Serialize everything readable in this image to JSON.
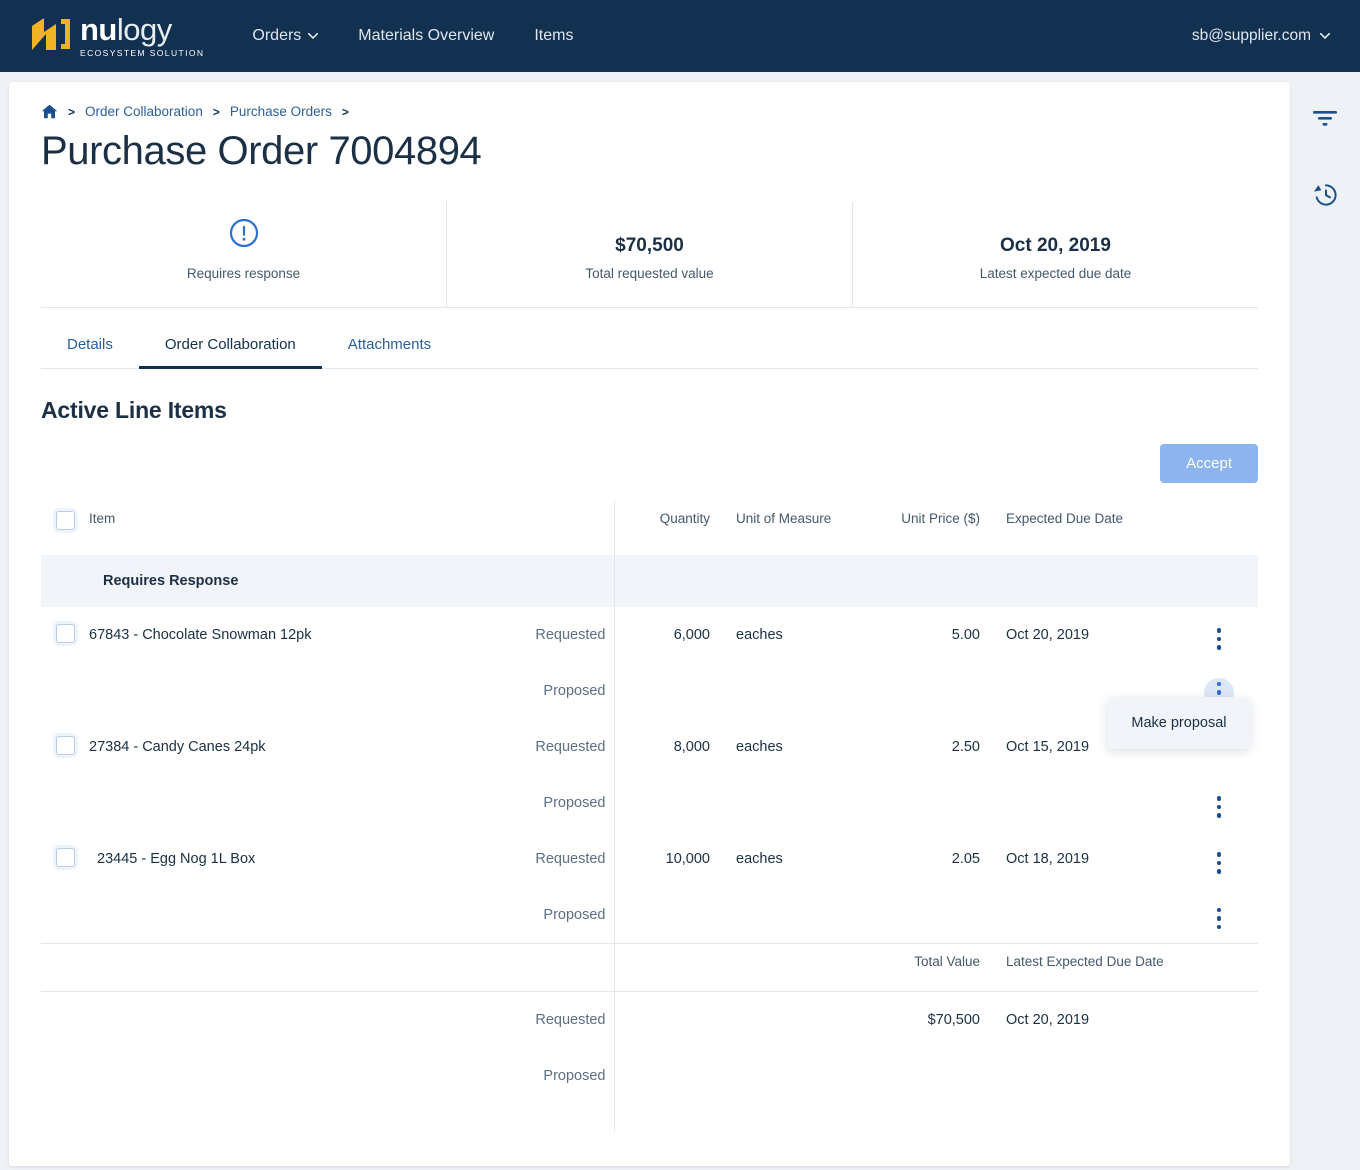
{
  "brand": {
    "word_bold": "nu",
    "word_light": "logy",
    "tagline": "ECOSYSTEM SOLUTION",
    "mark_color": "#f0b323",
    "navy": "#12304f",
    "accent_blue": "#2a5f9e"
  },
  "nav": {
    "items": [
      {
        "label": "Orders",
        "has_caret": true
      },
      {
        "label": "Materials Overview",
        "has_caret": false
      },
      {
        "label": "Items",
        "has_caret": false
      }
    ],
    "user_email": "sb@supplier.com"
  },
  "rail": {
    "filter_icon": "filter-icon",
    "history_icon": "history-icon"
  },
  "breadcrumb": {
    "home_icon": "home-icon",
    "items": [
      "Order Collaboration",
      "Purchase Orders"
    ],
    "separator": ">"
  },
  "page": {
    "title": "Purchase Order 7004894"
  },
  "stats": [
    {
      "icon": "alert-circle-icon",
      "value": "",
      "label": "Requires response"
    },
    {
      "icon": "",
      "value": "$70,500",
      "label": "Total requested value"
    },
    {
      "icon": "",
      "value": "Oct 20, 2019",
      "label": "Latest expected due date"
    }
  ],
  "tabs": [
    {
      "label": "Details",
      "active": false
    },
    {
      "label": "Order Collaboration",
      "active": true
    },
    {
      "label": "Attachments",
      "active": false
    }
  ],
  "section": {
    "title": "Active Line Items",
    "accept_label": "Accept"
  },
  "table": {
    "headers": {
      "item": "Item",
      "quantity": "Quantity",
      "unit_of_measure": "Unit of Measure",
      "unit_price": "Unit Price ($)",
      "expected_due_date": "Expected Due Date"
    },
    "group_label": "Requires Response",
    "side_labels": {
      "requested": "Requested",
      "proposed": "Proposed"
    },
    "rows": [
      {
        "item": "67843 - Chocolate Snowman 12pk",
        "requested": {
          "quantity": "6,000",
          "uom": "eaches",
          "unit_price": "5.00",
          "due_date": "Oct 20, 2019"
        },
        "proposed": {
          "quantity": "",
          "uom": "",
          "unit_price": "",
          "due_date": ""
        },
        "menu_open_on_proposed": true
      },
      {
        "item": "27384 - Candy Canes 24pk",
        "requested": {
          "quantity": "8,000",
          "uom": "eaches",
          "unit_price": "2.50",
          "due_date": "Oct 15, 2019"
        },
        "proposed": {
          "quantity": "",
          "uom": "",
          "unit_price": "",
          "due_date": ""
        },
        "menu_open_on_proposed": false
      },
      {
        "item": "23445 - Egg Nog 1L Box",
        "requested": {
          "quantity": "10,000",
          "uom": "eaches",
          "unit_price": "2.05",
          "due_date": "Oct 18, 2019"
        },
        "proposed": {
          "quantity": "",
          "uom": "",
          "unit_price": "",
          "due_date": ""
        },
        "menu_open_on_proposed": false
      }
    ],
    "footer": {
      "total_value_header": "Total Value",
      "latest_due_header": "Latest Expected Due Date",
      "requested_label": "Requested",
      "proposed_label": "Proposed",
      "requested_total_value": "$70,500",
      "requested_latest_due": "Oct 20, 2019",
      "proposed_total_value": "",
      "proposed_latest_due": ""
    }
  },
  "popover": {
    "make_proposal_label": "Make proposal"
  }
}
